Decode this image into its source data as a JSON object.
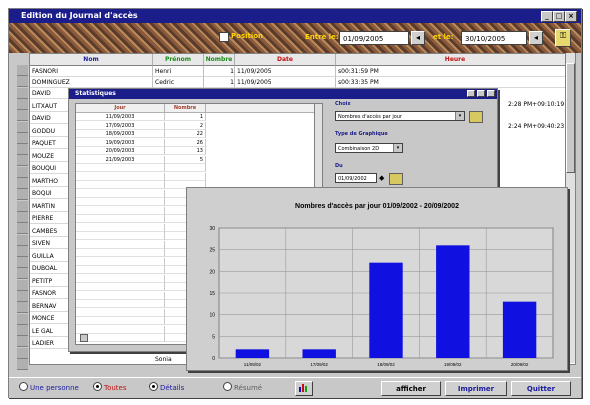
{
  "window": {
    "title": "Edition du Journal d'accès"
  },
  "toolbar": {
    "position_label": "Position",
    "from_label": "Entre le:",
    "from_date": "01/09/2005",
    "to_label": "et le:",
    "to_date": "30/10/2005"
  },
  "grid": {
    "headers": [
      "Nom",
      "Prénom",
      "Nombre",
      "Date",
      "Heure"
    ],
    "rows": [
      {
        "nom": "FASNORI",
        "prenom": "Henri",
        "nombre": "1",
        "date": "11/09/2005",
        "heure": "s00:31:59 PM"
      },
      {
        "nom": "DOMINGUEZ",
        "prenom": "Cedric",
        "nombre": "1",
        "date": "11/09/2005",
        "heure": "s00:33:35 PM"
      }
    ],
    "names": [
      "DAVID",
      "LITXAUT",
      "DAVID",
      "GODDU",
      "PAQUET",
      "MOUZE",
      "BOUQUI",
      "MARTHO",
      "BOQUI",
      "MARTIN",
      "PIERRE",
      "CAMBES",
      "SIVEN",
      "GUILLA",
      "DUBOAL",
      "PETITP",
      "FASNOR",
      "BERNAV",
      "MONCE",
      "LE GAL",
      "LADIER"
    ],
    "right_partial": [
      "2:28 PM+09:10:19",
      "2:24 PM+09:40:23"
    ],
    "last_row_prenom": "Sonia"
  },
  "stats": {
    "title": "Statistiques",
    "table_headers": [
      "Jour",
      "Nombre"
    ],
    "table_rows": [
      {
        "jour": "11/09/2003",
        "nombre": "1"
      },
      {
        "jour": "17/09/2003",
        "nombre": "2"
      },
      {
        "jour": "18/09/2003",
        "nombre": "22"
      },
      {
        "jour": "19/09/2003",
        "nombre": "26"
      },
      {
        "jour": "20/09/2003",
        "nombre": "13"
      },
      {
        "jour": "21/09/2003",
        "nombre": "5"
      }
    ],
    "choix_label": "Choix",
    "choix_value": "Nombres d'accès par jour",
    "type_label": "Type de Graphique",
    "type_value": "Combinaison 2D",
    "du_label": "Du",
    "du_value": "01/09/2002"
  },
  "chart_data": {
    "type": "bar",
    "title": "Nombres d'accès par jour  01/09/2002 - 20/09/2002",
    "categories": [
      "11/09/02",
      "17/09/02",
      "18/09/02",
      "19/09/02",
      "20/09/02"
    ],
    "values": [
      2,
      2,
      22,
      26,
      13
    ],
    "ylim": [
      0,
      30
    ],
    "yticks": [
      "0",
      "5",
      "10",
      "15",
      "20",
      "25",
      "30"
    ],
    "bar_color": "#1010e0",
    "grid": true
  },
  "bottom": {
    "radio_one": "Une personne",
    "radio_all": "Toutes",
    "radio_detail": "Détails",
    "radio_resume": "Résumé",
    "btn_afficher": "afficher",
    "btn_imprimer": "Imprimer",
    "btn_quitter": "Quitter"
  }
}
